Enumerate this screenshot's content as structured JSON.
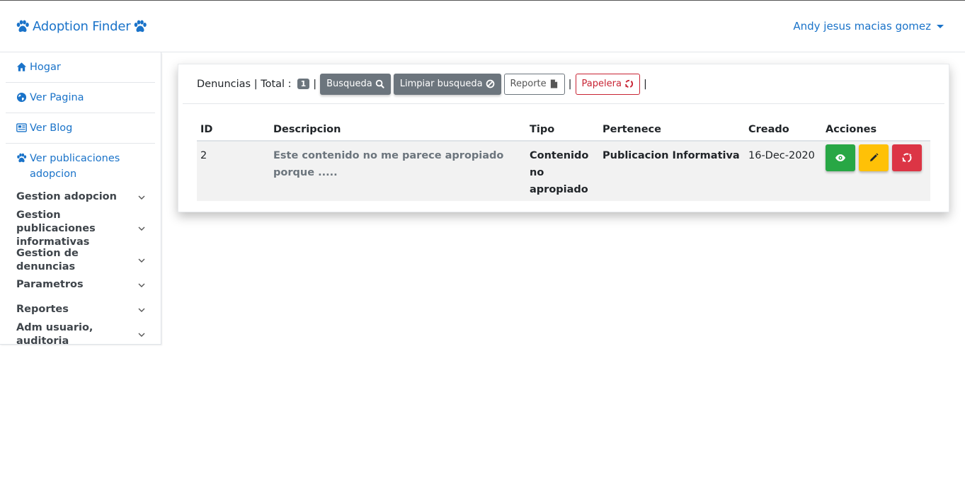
{
  "brand": {
    "title": "Adoption Finder",
    "icon": "paw-icon",
    "color": "#1a73c9"
  },
  "user": {
    "name": "Andy jesus macias gomez"
  },
  "sidebar": {
    "links": [
      {
        "label": "Hogar",
        "icon": "home-icon"
      },
      {
        "label": "Ver Pagina",
        "icon": "globe-icon"
      },
      {
        "label": "Ver Blog",
        "icon": "newspaper-icon"
      },
      {
        "label": "Ver publicaciones adopcion",
        "icon": "paw-icon"
      }
    ],
    "groups": [
      {
        "label": "Gestion adopcion"
      },
      {
        "label": "Gestion publicaciones informativas"
      },
      {
        "label": "Gestion de denuncias"
      },
      {
        "label": "Parametros"
      },
      {
        "label": "Reportes"
      },
      {
        "label": "Adm usuario, auditoria"
      }
    ]
  },
  "toolbar": {
    "title": "Denuncias | Total :",
    "total": "1",
    "separator": "|",
    "search_label": "Busqueda",
    "clear_label": "Limpiar busqueda",
    "report_label": "Reporte",
    "trash_label": "Papelera"
  },
  "table": {
    "headers": [
      "ID",
      "Descripcion",
      "Tipo",
      "Pertenece",
      "Creado",
      "Acciones"
    ],
    "rows": [
      {
        "id": "2",
        "descripcion": "Este contenido no me parece apropiado porque .....",
        "tipo": "Contenido no apropiado",
        "pertenece": "Publicacion Informativa",
        "creado": "16-Dec-2020"
      }
    ]
  },
  "colors": {
    "view": "#28a745",
    "edit": "#ffc107",
    "delete": "#dc3545",
    "link": "#1a73c9"
  }
}
